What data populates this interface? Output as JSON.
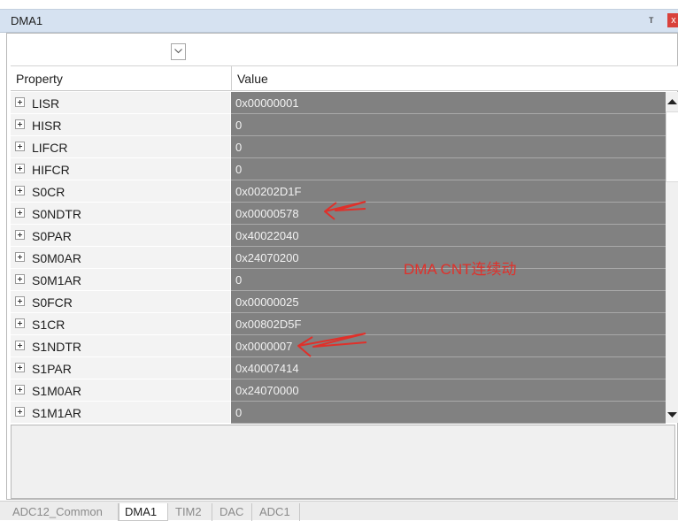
{
  "window": {
    "title": "DMA1",
    "pin_glyph": "т",
    "close_glyph": "x"
  },
  "header": {
    "property": "Property",
    "value": "Value"
  },
  "rows": [
    {
      "name": "LISR",
      "value": "0x00000001"
    },
    {
      "name": "HISR",
      "value": "0"
    },
    {
      "name": "LIFCR",
      "value": "0"
    },
    {
      "name": "HIFCR",
      "value": "0"
    },
    {
      "name": "S0CR",
      "value": "0x00202D1F"
    },
    {
      "name": "S0NDTR",
      "value": "0x00000578"
    },
    {
      "name": "S0PAR",
      "value": "0x40022040"
    },
    {
      "name": "S0M0AR",
      "value": "0x24070200"
    },
    {
      "name": "S0M1AR",
      "value": "0"
    },
    {
      "name": "S0FCR",
      "value": "0x00000025"
    },
    {
      "name": "S1CR",
      "value": "0x00802D5F"
    },
    {
      "name": "S1NDTR",
      "value": "0x0000007"
    },
    {
      "name": "S1PAR",
      "value": "0x40007414"
    },
    {
      "name": "S1M0AR",
      "value": "0x24070000"
    },
    {
      "name": "S1M1AR",
      "value": "0"
    }
  ],
  "annotation": {
    "text": "DMA CNT连续动",
    "color": "#e0302a"
  },
  "tabs": [
    {
      "label": "ADC12_Common",
      "active": false
    },
    {
      "label": "DMA1",
      "active": true
    },
    {
      "label": "TIM2",
      "active": false
    },
    {
      "label": "DAC",
      "active": false
    },
    {
      "label": "ADC1",
      "active": false
    }
  ],
  "colors": {
    "titlebar": "#d6e2f1",
    "value_cell": "#818181",
    "name_cell": "#f3f3f3"
  }
}
